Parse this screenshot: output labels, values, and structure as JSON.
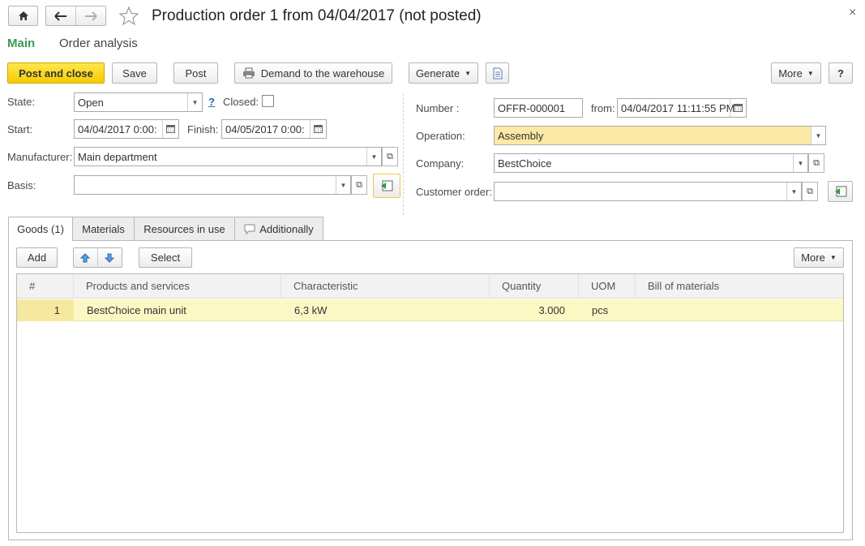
{
  "header": {
    "title": "Production order 1 from 04/04/2017 (not posted)",
    "close_glyph": "×"
  },
  "nav": {
    "main": "Main",
    "order_analysis": "Order analysis"
  },
  "toolbar": {
    "post_and_close": "Post and close",
    "save": "Save",
    "post": "Post",
    "demand": "Demand to the warehouse",
    "generate": "Generate",
    "more": "More",
    "help": "?"
  },
  "form": {
    "state_label": "State:",
    "state_value": "Open",
    "help_link": "?",
    "closed_label": "Closed:",
    "start_label": "Start:",
    "start_value": "04/04/2017  0:00:",
    "finish_label": "Finish:",
    "finish_value": "04/05/2017  0:00:",
    "manufacturer_label": "Manufacturer:",
    "manufacturer_value": "Main department",
    "basis_label": "Basis:",
    "basis_value": "",
    "number_label": "Number :",
    "number_value": "OFFR-000001",
    "from_label": "from:",
    "from_value": "04/04/2017 11:11:55 PM",
    "operation_label": "Operation:",
    "operation_value": "Assembly",
    "company_label": "Company:",
    "company_value": "BestChoice",
    "customer_order_label": "Customer order:",
    "customer_order_value": ""
  },
  "tabs": [
    {
      "label": "Goods (1)"
    },
    {
      "label": "Materials"
    },
    {
      "label": "Resources in use"
    },
    {
      "label": "Additionally"
    }
  ],
  "table_toolbar": {
    "add": "Add",
    "select": "Select",
    "more": "More"
  },
  "table": {
    "columns": [
      "#",
      "Products and services",
      "Characteristic",
      "Quantity",
      "UOM",
      "Bill of materials"
    ],
    "rows": [
      {
        "num": "1",
        "product": "BestChoice main unit",
        "characteristic": "6,3 kW",
        "quantity": "3.000",
        "uom": "pcs",
        "bom": ""
      }
    ]
  },
  "colors": {
    "accent_green": "#3d9b54",
    "primary_yellow": "#f5cc00",
    "highlight_row": "#fbf8c4",
    "operation_field": "#fbe9a6"
  }
}
